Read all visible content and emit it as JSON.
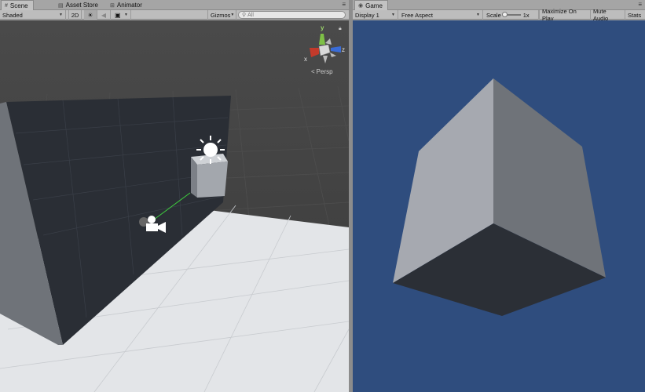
{
  "scene": {
    "tabs": [
      {
        "label": "Scene",
        "icon": "scene-icon"
      },
      {
        "label": "Asset Store",
        "icon": "store-icon"
      },
      {
        "label": "Animator",
        "icon": "animator-icon"
      }
    ],
    "toolbar": {
      "shading_mode": "Shaded",
      "mode_2d": "2D",
      "gizmos": "Gizmos",
      "search_placeholder": "All"
    },
    "gizmo": {
      "y_label": "y",
      "x_label": "x",
      "z_label": "z",
      "projection": "Persp"
    }
  },
  "game": {
    "tab_label": "Game",
    "toolbar": {
      "display": "Display 1",
      "aspect": "Free Aspect",
      "scale_label": "Scale",
      "scale_value": "1x",
      "maximize": "Maximize On Play",
      "mute": "Mute Audio",
      "stats": "Stats"
    },
    "background_color": "#2f4d7e"
  },
  "colors": {
    "scene_bg_dark": "#3b3b3b",
    "wall": "#2a2e35",
    "floor": "#e3e5e8",
    "cube_light": "#a6a9b0",
    "cube_mid": "#6f7379",
    "cube_dark": "#2b2f36"
  }
}
